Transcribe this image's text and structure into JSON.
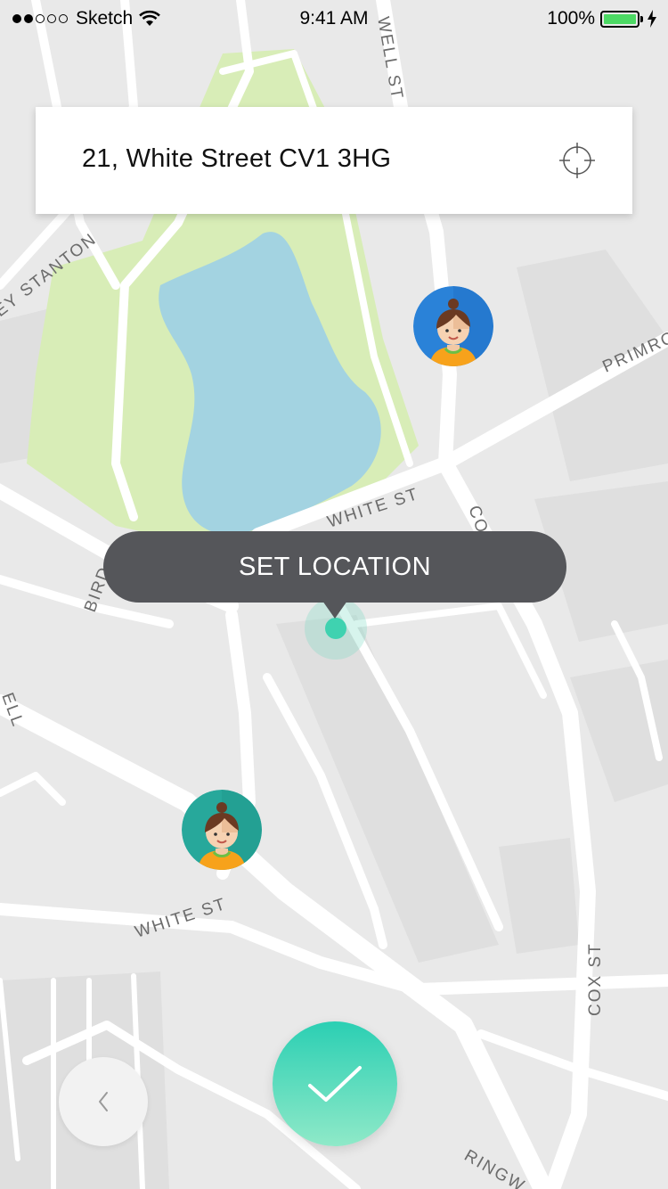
{
  "status_bar": {
    "carrier": "Sketch",
    "time": "9:41 AM",
    "battery": "100%",
    "signal_icon": "signal-dots-icon",
    "wifi_icon": "wifi-icon",
    "charging_icon": "bolt-icon"
  },
  "map": {
    "street_labels": [
      "WHITE ST",
      "WHITE ST",
      "COX ST",
      "PRIMRO",
      "RINGW",
      "BIRD",
      "ELL",
      "EY STANTON",
      "WELL ST",
      "CO"
    ],
    "colors": {
      "background": "#e9e9e9",
      "road": "#ffffff",
      "park": "#d8edb7",
      "water": "#a3d3e1"
    }
  },
  "search": {
    "address": "21, White Street CV1 3HG",
    "locate_icon": "crosshair-icon"
  },
  "markers": {
    "driver_1_icon": "driver-avatar-icon",
    "driver_2_icon": "driver-avatar-icon",
    "driver_1_color": "#2a82d8",
    "driver_2_color": "#27a89b"
  },
  "tooltip": {
    "label": "SET LOCATION"
  },
  "actions": {
    "back_icon": "chevron-left-icon",
    "confirm_icon": "checkmark-icon",
    "confirm_color": "#2bcfb3"
  }
}
